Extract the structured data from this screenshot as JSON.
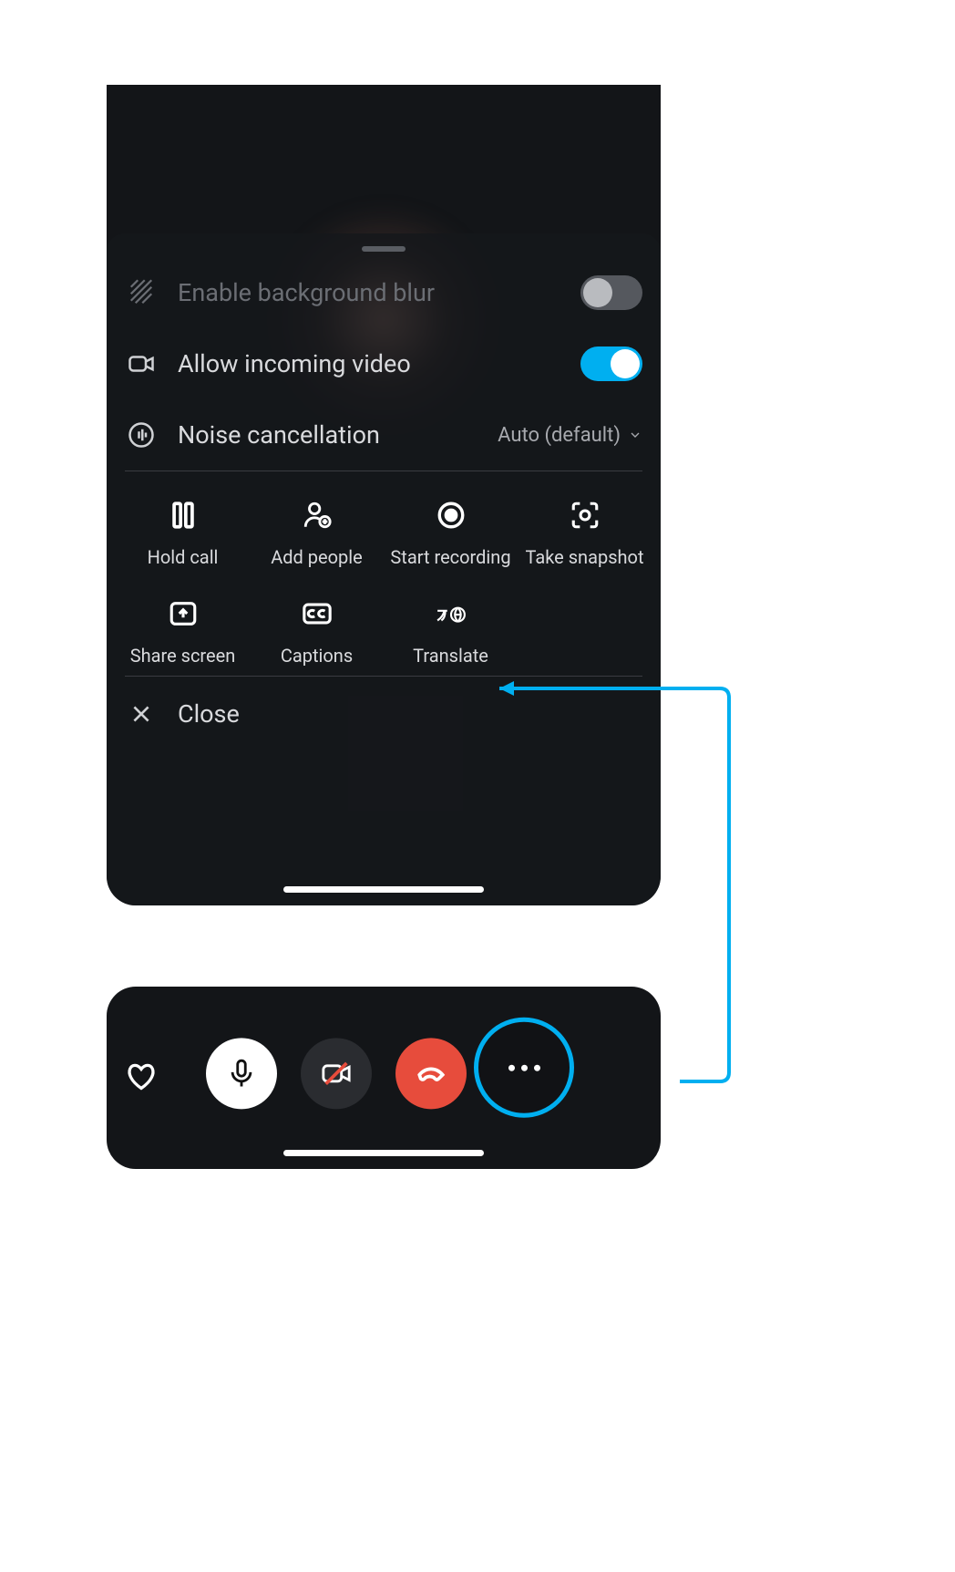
{
  "settings": {
    "blur": {
      "label": "Enable background blur",
      "enabled": false,
      "toggled": false
    },
    "incomingVideo": {
      "label": "Allow incoming video",
      "toggled": true
    },
    "noise": {
      "label": "Noise cancellation",
      "value": "Auto (default)"
    }
  },
  "actions": {
    "hold": "Hold call",
    "addPeople": "Add people",
    "record": "Start recording",
    "snapshot": "Take snapshot",
    "share": "Share screen",
    "captions": "Captions",
    "translate": "Translate"
  },
  "close": "Close",
  "annotation": {
    "color": "#00aff0"
  }
}
